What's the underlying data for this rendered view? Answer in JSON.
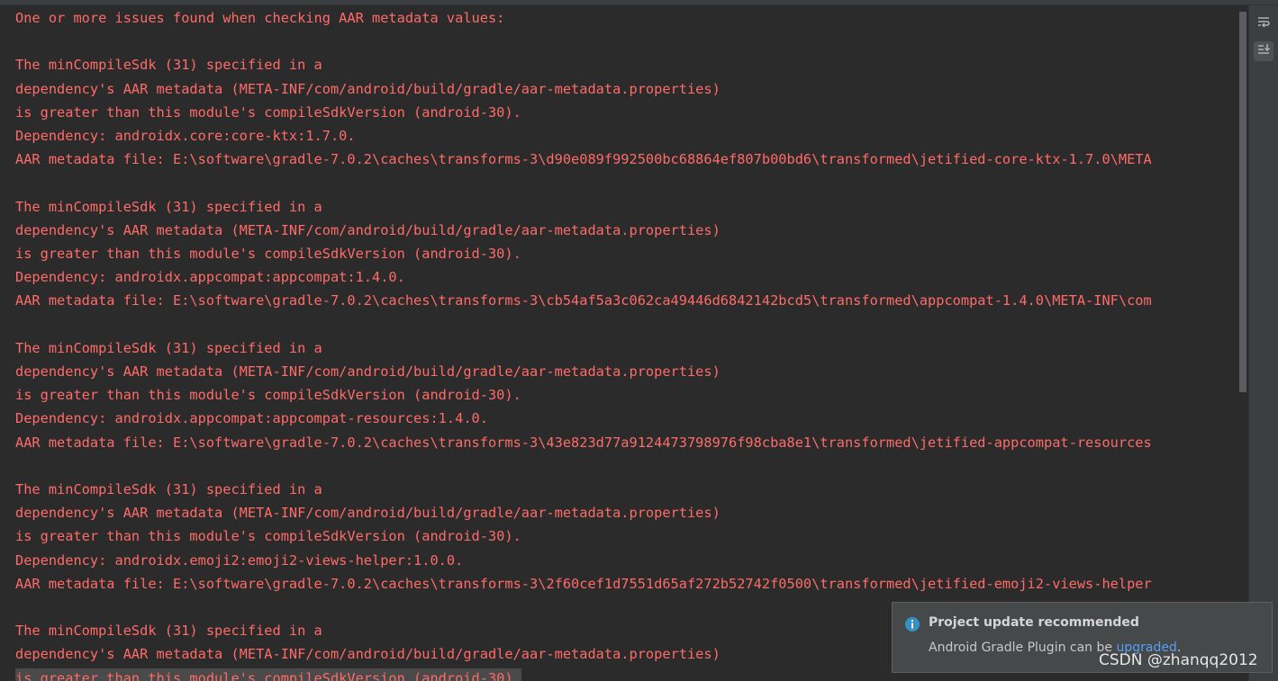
{
  "console": {
    "lines": [
      "One or more issues found when checking AAR metadata values:",
      "",
      "The minCompileSdk (31) specified in a",
      "dependency's AAR metadata (META-INF/com/android/build/gradle/aar-metadata.properties)",
      "is greater than this module's compileSdkVersion (android-30).",
      "Dependency: androidx.core:core-ktx:1.7.0.",
      "AAR metadata file: E:\\software\\gradle-7.0.2\\caches\\transforms-3\\d90e089f992500bc68864ef807b00bd6\\transformed\\jetified-core-ktx-1.7.0\\META",
      "",
      "The minCompileSdk (31) specified in a",
      "dependency's AAR metadata (META-INF/com/android/build/gradle/aar-metadata.properties)",
      "is greater than this module's compileSdkVersion (android-30).",
      "Dependency: androidx.appcompat:appcompat:1.4.0.",
      "AAR metadata file: E:\\software\\gradle-7.0.2\\caches\\transforms-3\\cb54af5a3c062ca49446d6842142bcd5\\transformed\\appcompat-1.4.0\\META-INF\\com",
      "",
      "The minCompileSdk (31) specified in a",
      "dependency's AAR metadata (META-INF/com/android/build/gradle/aar-metadata.properties)",
      "is greater than this module's compileSdkVersion (android-30).",
      "Dependency: androidx.appcompat:appcompat-resources:1.4.0.",
      "AAR metadata file: E:\\software\\gradle-7.0.2\\caches\\transforms-3\\43e823d77a9124473798976f98cba8e1\\transformed\\jetified-appcompat-resources",
      "",
      "The minCompileSdk (31) specified in a",
      "dependency's AAR metadata (META-INF/com/android/build/gradle/aar-metadata.properties)",
      "is greater than this module's compileSdkVersion (android-30).",
      "Dependency: androidx.emoji2:emoji2-views-helper:1.0.0.",
      "AAR metadata file: E:\\software\\gradle-7.0.2\\caches\\transforms-3\\2f60cef1d7551d65af272b52742f0500\\transformed\\jetified-emoji2-views-helper",
      "",
      "The minCompileSdk (31) specified in a",
      "dependency's AAR metadata (META-INF/com/android/build/gradle/aar-metadata.properties)",
      "is greater than this module's compileSdkVersion (android-30)."
    ],
    "text_color": "#ff6b68"
  },
  "toolbar": {
    "soft_wrap_icon": "soft-wrap-icon",
    "scroll_to_end_icon": "scroll-to-end-icon"
  },
  "notification": {
    "title": "Project update recommended",
    "body_prefix": "Android Gradle Plugin can be ",
    "link": "upgraded",
    "body_suffix": ".",
    "icon": "info-icon"
  },
  "watermark": "CSDN @zhanqq2012"
}
